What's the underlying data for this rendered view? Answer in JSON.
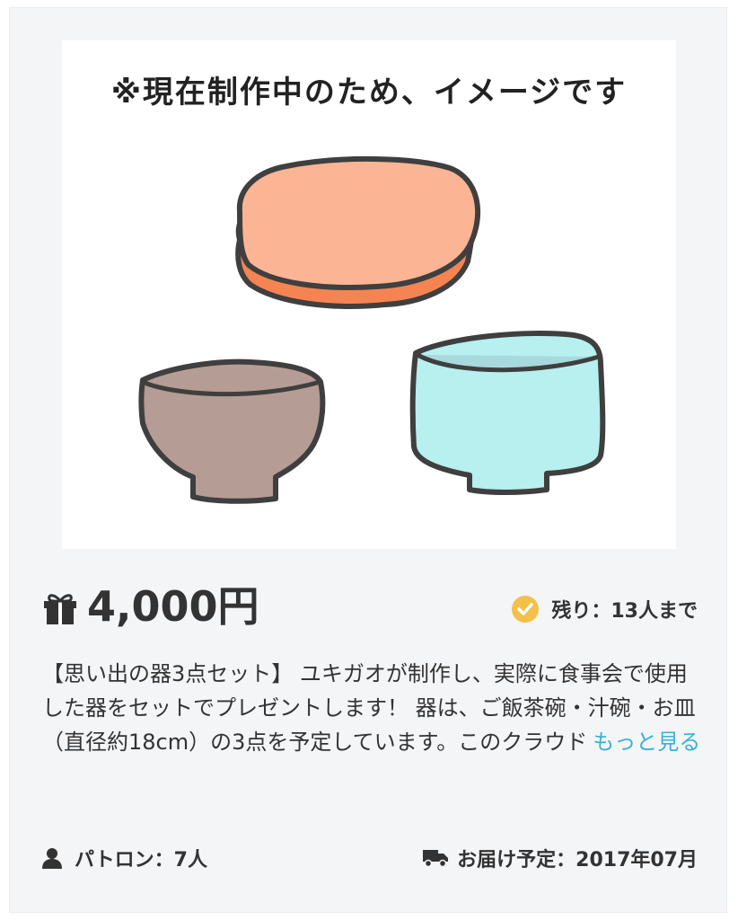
{
  "reward": {
    "image_caption": "※現在制作中のため、イメージです",
    "price": "4,000円",
    "remaining": "残り：13人まで",
    "description": "【思い出の器3点セット】 ユキガオが制作し、実際に食事会で使用した器をセットでプレゼントします！ 器は、ご飯茶碗・汁碗・お皿（直径約18cm）の3点を予定しています。このクラウド",
    "more_link": "もっと見る",
    "patrons": "パトロン：7人",
    "delivery": "お届け予定：2017年07月"
  },
  "icons": {
    "price": "gift-icon",
    "remaining": "check-circle-icon",
    "patrons": "person-icon",
    "delivery": "truck-icon"
  },
  "colors": {
    "link": "#3bb1d6",
    "check_badge": "#f3c04b",
    "text": "#333333",
    "card_background": "#f4f5f7",
    "plate_top": "#fbb595",
    "plate_bottom": "#f68453",
    "bowl_brown": "#b59c94",
    "bowl_cyan": "#b8efef"
  }
}
